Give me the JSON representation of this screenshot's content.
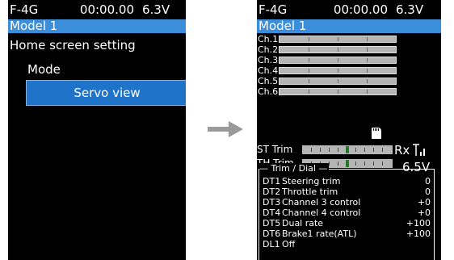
{
  "status": {
    "model": "F-4G",
    "time": "00:00.00",
    "voltage": "6.3V"
  },
  "model_name": "Model 1",
  "left": {
    "heading": "Home screen setting",
    "mode_label": "Mode",
    "mode_value": "Servo view"
  },
  "right": {
    "channels": [
      "Ch.1",
      "Ch.2",
      "Ch.3",
      "Ch.4",
      "Ch.5",
      "Ch.6"
    ],
    "st_trim_label": "ST Trim",
    "th_trim_label": "TH Trim",
    "rx_label": "Rx",
    "rx_voltage": "6.5V",
    "dial_title": "Trim / Dial",
    "dial_items": [
      {
        "key": "DT1",
        "name": "Steering trim",
        "value": "0"
      },
      {
        "key": "DT2",
        "name": "Throttle trim",
        "value": "0"
      },
      {
        "key": "DT3",
        "name": "Channel 3 control",
        "value": "+0"
      },
      {
        "key": "DT4",
        "name": "Channel 4 control",
        "value": "+0"
      },
      {
        "key": "DT5",
        "name": "Dual rate",
        "value": "+100"
      },
      {
        "key": "DT6",
        "name": "Brake1 rate(ATL)",
        "value": "+100"
      },
      {
        "key": "DL1",
        "name": "Off",
        "value": ""
      }
    ]
  },
  "icons": {
    "arrow": "right-arrow-icon",
    "sd": "sd-card-icon",
    "antenna": "signal-antenna-icon"
  },
  "colors": {
    "model_bar": "#3b8ed9",
    "button": "#1f73c9",
    "background": "#000000",
    "trim_center": "#2e7d32"
  }
}
